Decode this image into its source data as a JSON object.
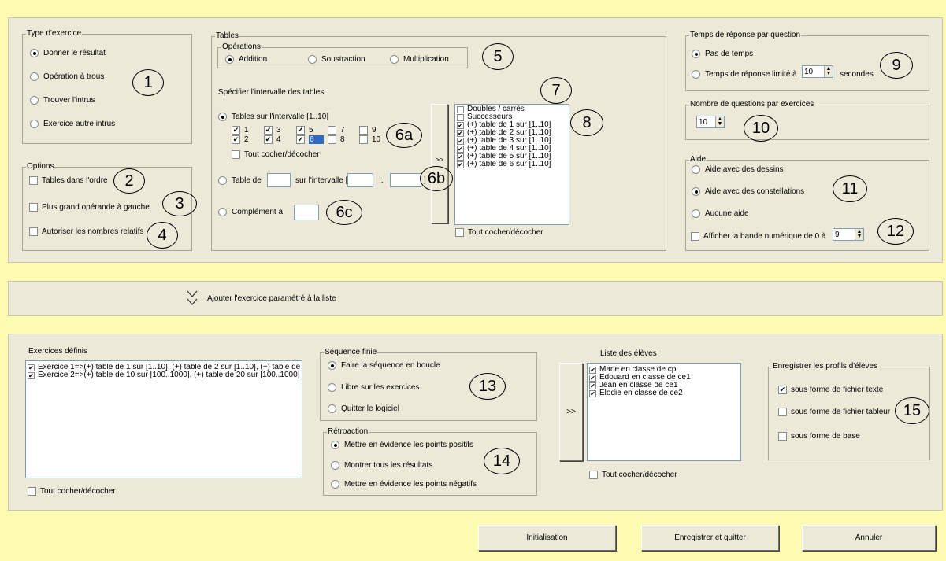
{
  "type_exercice": {
    "legend": "Type d'exercice",
    "options": [
      "Donner le résultat",
      "Opération à trous",
      "Trouver l'intrus",
      "Exercice autre intrus"
    ],
    "selected": 0,
    "marker": "1"
  },
  "options_group": {
    "legend": "Options",
    "items": [
      "Tables dans l'ordre",
      "Plus grand opérande à gauche",
      "Autoriser les nombres relatifs"
    ],
    "markers": [
      "2",
      "3",
      "4"
    ]
  },
  "tables": {
    "legend": "Tables",
    "operations": {
      "legend": "Opérations",
      "items": [
        "Addition",
        "Soustraction",
        "Multiplication"
      ],
      "selected": 0,
      "marker": "5"
    },
    "intervalle_label": "Spécifier l'intervalle des tables",
    "radio_intervalle": "Tables sur l'intervalle [1..10]",
    "nums": [
      "1",
      "2",
      "3",
      "4",
      "5",
      "6",
      "7",
      "8",
      "9",
      "10"
    ],
    "checked": [
      true,
      true,
      true,
      true,
      true,
      true,
      false,
      false,
      false,
      false
    ],
    "selected_num": "6",
    "tout_cocher": "Tout cocher/décocher",
    "table_de": "Table de",
    "sur_intervalle": "sur l'intervalle [",
    "dots": "..",
    "bracket": "]",
    "complement": "Complément à",
    "markers": {
      "m6a": "6a",
      "m6b": "6b",
      "m6c": "6c",
      "m7": "7",
      "m8": "8"
    },
    "transfer_arrow": ">>",
    "list": [
      {
        "label": "Doubles / carrés",
        "checked": false
      },
      {
        "label": "Successeurs",
        "checked": false
      },
      {
        "label": "(+) table de 1 sur [1..10]",
        "checked": true
      },
      {
        "label": "(+) table de 2 sur [1..10]",
        "checked": true
      },
      {
        "label": "(+) table de 3 sur [1..10]",
        "checked": true
      },
      {
        "label": "(+) table de 4 sur [1..10]",
        "checked": true
      },
      {
        "label": "(+) table de 5 sur [1..10]",
        "checked": true
      },
      {
        "label": "(+) table de 6 sur [1..10]",
        "checked": true
      }
    ],
    "list_tout": "Tout cocher/décocher"
  },
  "temps": {
    "legend": "Temps de réponse par question",
    "opt1": "Pas de temps",
    "opt2": "Temps de réponse limité à",
    "value": "10",
    "unit": "secondes",
    "marker": "9"
  },
  "nb_questions": {
    "legend": "Nombre de questions par exercices",
    "value": "10",
    "marker": "10"
  },
  "aide": {
    "legend": "Aide",
    "items": [
      "Aide avec des dessins",
      "Aide avec des constellations",
      "Aucune aide"
    ],
    "selected": 1,
    "bande": "Afficher la bande numérique de 0 à",
    "bande_value": "9",
    "markers": [
      "11",
      "12"
    ]
  },
  "ajouter": {
    "label": "Ajouter l'exercice paramétré à la liste",
    "icon": "chevron-double-down"
  },
  "exercices": {
    "title": "Exercices définis",
    "items": [
      "Exercice 1=>(+) table de 1 sur [1..10], (+) table de 2 sur [1..10], (+) table de",
      "Exercice 2=>(+) table de 10 sur [100..1000], (+) table de 20 sur [100..1000]"
    ],
    "tout": "Tout cocher/décocher"
  },
  "sequence": {
    "legend": "Séquence finie",
    "items": [
      "Faire la séquence en boucle",
      "Libre sur les exercices",
      "Quitter le logiciel"
    ],
    "selected": 0,
    "marker": "13"
  },
  "retroaction": {
    "legend": "Rétroaction",
    "items": [
      "Mettre en évidence les points positifs",
      "Montrer tous les résultats",
      "Mettre en évidence les points négatifs"
    ],
    "selected": 0,
    "marker": "14"
  },
  "eleves": {
    "title": "Liste des élèves",
    "arrow": ">>",
    "items": [
      "Marie en classe de cp",
      "Edouard en classe de ce1",
      "Jean en classe de ce1",
      "Élodie en classe de ce2"
    ],
    "tout": "Tout cocher/décocher"
  },
  "profils": {
    "legend": "Enregistrer les profils d'élèves",
    "items": [
      "sous forme de fichier texte",
      "sous forme de fichier tableur",
      "sous forme de base"
    ],
    "checked": [
      true,
      false,
      false
    ],
    "marker": "15"
  },
  "buttons": {
    "init": "Initialisation",
    "save": "Enregistrer et quitter",
    "cancel": "Annuler"
  }
}
